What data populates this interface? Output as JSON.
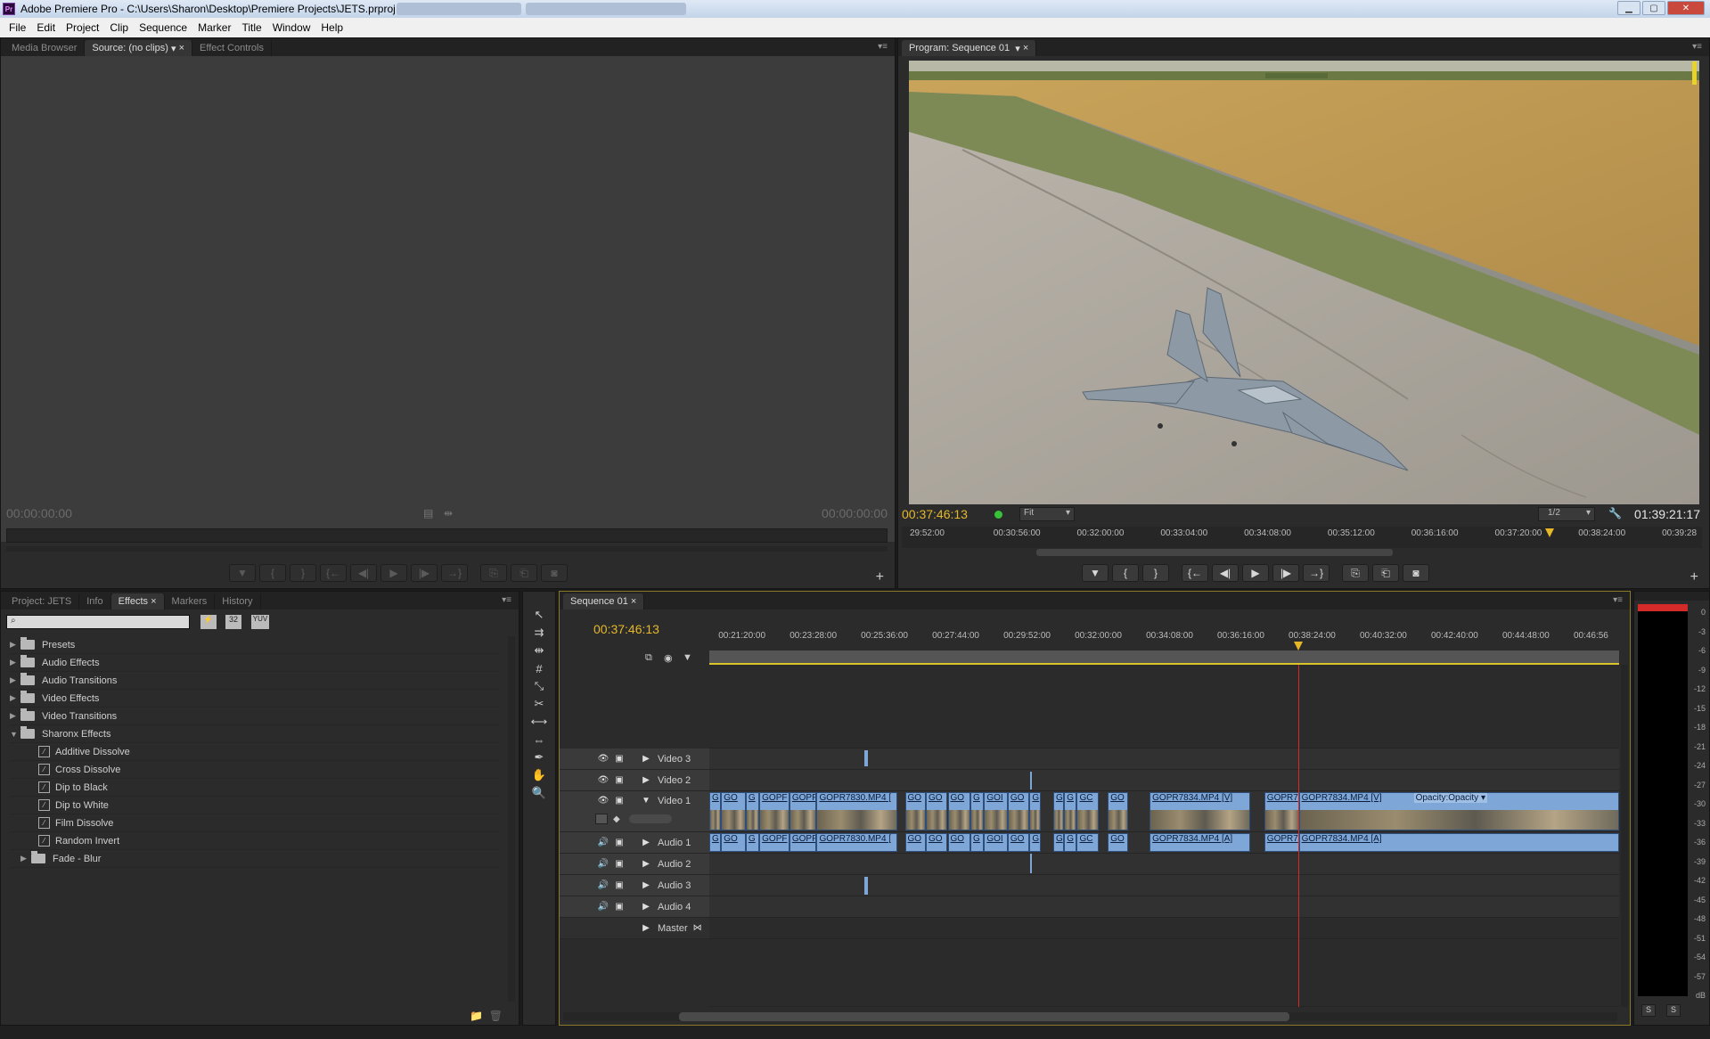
{
  "window": {
    "title": "Adobe Premiere Pro - C:\\Users\\Sharon\\Desktop\\Premiere Projects\\JETS.prproj *",
    "app_icon": "Pr"
  },
  "menu": [
    "File",
    "Edit",
    "Project",
    "Clip",
    "Sequence",
    "Marker",
    "Title",
    "Window",
    "Help"
  ],
  "source_panel": {
    "tabs": [
      "Media Browser",
      "Source: (no clips)",
      "Effect Controls"
    ],
    "timecode_in": "00:00:00:00",
    "timecode_out": "00:00:00:00"
  },
  "program_panel": {
    "tab": "Program: Sequence 01",
    "current_timecode": "00:37:46:13",
    "fit": "Fit",
    "resolution": "1/2",
    "duration": "01:39:21:17",
    "ruler": [
      "29:52:00",
      "00:30:56:00",
      "00:32:00:00",
      "00:33:04:00",
      "00:34:08:00",
      "00:35:12:00",
      "00:36:16:00",
      "00:37:20:00",
      "00:38:24:00",
      "00:39:28"
    ],
    "playhead_position": 0.81
  },
  "project_panel": {
    "tabs": [
      "Project: JETS",
      "Info",
      "Effects",
      "Markers",
      "History"
    ],
    "search_placeholder": "",
    "icon_labels": [
      "32",
      "YUV"
    ],
    "tree": [
      {
        "label": "Presets",
        "type": "folder",
        "expanded": false,
        "indent": 0
      },
      {
        "label": "Audio Effects",
        "type": "folder",
        "expanded": false,
        "indent": 0
      },
      {
        "label": "Audio Transitions",
        "type": "folder",
        "expanded": false,
        "indent": 0
      },
      {
        "label": "Video Effects",
        "type": "folder",
        "expanded": false,
        "indent": 0
      },
      {
        "label": "Video Transitions",
        "type": "folder",
        "expanded": false,
        "indent": 0
      },
      {
        "label": "Sharonx Effects",
        "type": "folder",
        "expanded": true,
        "indent": 0
      },
      {
        "label": "Additive Dissolve",
        "type": "effect",
        "indent": 1
      },
      {
        "label": "Cross Dissolve",
        "type": "effect",
        "indent": 1
      },
      {
        "label": "Dip to Black",
        "type": "effect",
        "indent": 1
      },
      {
        "label": "Dip to White",
        "type": "effect",
        "indent": 1
      },
      {
        "label": "Film Dissolve",
        "type": "effect",
        "indent": 1
      },
      {
        "label": "Random Invert",
        "type": "effect",
        "indent": 1
      },
      {
        "label": "Fade - Blur",
        "type": "folder",
        "expanded": false,
        "indent": 1
      }
    ]
  },
  "timeline": {
    "tab": "Sequence 01",
    "current_timecode": "00:37:46:13",
    "ruler": [
      "00:21:20:00",
      "00:23:28:00",
      "00:25:36:00",
      "00:27:44:00",
      "00:29:52:00",
      "00:32:00:00",
      "00:34:08:00",
      "00:36:16:00",
      "00:38:24:00",
      "00:40:32:00",
      "00:42:40:00",
      "00:44:48:00",
      "00:46:56"
    ],
    "playhead_position": 0.647,
    "tracks": {
      "video3": "Video 3",
      "video2": "Video 2",
      "video1": "Video 1",
      "audio1": "Audio 1",
      "audio2": "Audio 2",
      "audio3": "Audio 3",
      "audio4": "Audio 4",
      "master": "Master"
    },
    "video1_clips": [
      {
        "label": "G",
        "start": 0.0,
        "end": 0.013
      },
      {
        "label": "GO",
        "start": 0.013,
        "end": 0.04
      },
      {
        "label": "G",
        "start": 0.04,
        "end": 0.055
      },
      {
        "label": "GOPF",
        "start": 0.055,
        "end": 0.088
      },
      {
        "label": "GOPF",
        "start": 0.088,
        "end": 0.118
      },
      {
        "label": "GOPR7830.MP4 [",
        "start": 0.118,
        "end": 0.207
      },
      {
        "label": "GO",
        "start": 0.215,
        "end": 0.238
      },
      {
        "label": "GO",
        "start": 0.238,
        "end": 0.262
      },
      {
        "label": "GO",
        "start": 0.262,
        "end": 0.287
      },
      {
        "label": "G",
        "start": 0.287,
        "end": 0.302
      },
      {
        "label": "GOI",
        "start": 0.302,
        "end": 0.328
      },
      {
        "label": "GO",
        "start": 0.328,
        "end": 0.352
      },
      {
        "label": "G",
        "start": 0.352,
        "end": 0.364
      },
      {
        "label": "G",
        "start": 0.378,
        "end": 0.39
      },
      {
        "label": "G",
        "start": 0.39,
        "end": 0.404
      },
      {
        "label": "GC",
        "start": 0.404,
        "end": 0.428
      },
      {
        "label": "GO",
        "start": 0.438,
        "end": 0.46
      },
      {
        "label": "GOPR7834.MP4 [V]",
        "start": 0.484,
        "end": 0.595
      },
      {
        "label": "GOPR7",
        "start": 0.61,
        "end": 0.648
      },
      {
        "label": "GOPR7834.MP4 [V]",
        "start": 0.648,
        "end": 1.0
      }
    ],
    "opacity_label": "Opacity:Opacity",
    "audio1_clips": [
      {
        "label": "G",
        "start": 0.0,
        "end": 0.013
      },
      {
        "label": "GO",
        "start": 0.013,
        "end": 0.04
      },
      {
        "label": "G",
        "start": 0.04,
        "end": 0.055
      },
      {
        "label": "GOPF",
        "start": 0.055,
        "end": 0.088
      },
      {
        "label": "GOPF",
        "start": 0.088,
        "end": 0.118
      },
      {
        "label": "GOPR7830.MP4 [",
        "start": 0.118,
        "end": 0.207
      },
      {
        "label": "GO",
        "start": 0.215,
        "end": 0.238
      },
      {
        "label": "GO",
        "start": 0.238,
        "end": 0.262
      },
      {
        "label": "GO",
        "start": 0.262,
        "end": 0.287
      },
      {
        "label": "G",
        "start": 0.287,
        "end": 0.302
      },
      {
        "label": "GOI",
        "start": 0.302,
        "end": 0.328
      },
      {
        "label": "GO",
        "start": 0.328,
        "end": 0.352
      },
      {
        "label": "G",
        "start": 0.352,
        "end": 0.364
      },
      {
        "label": "G",
        "start": 0.378,
        "end": 0.39
      },
      {
        "label": "G",
        "start": 0.39,
        "end": 0.404
      },
      {
        "label": "GC",
        "start": 0.404,
        "end": 0.428
      },
      {
        "label": "GO",
        "start": 0.438,
        "end": 0.46
      },
      {
        "label": "GOPR7834.MP4 [A]",
        "start": 0.484,
        "end": 0.595
      },
      {
        "label": "GOPR7",
        "start": 0.61,
        "end": 0.648
      },
      {
        "label": "GOPR7834.MP4 [A]",
        "start": 0.648,
        "end": 1.0
      }
    ]
  },
  "audio_meter": {
    "scale": [
      "0",
      "-3",
      "-6",
      "-9",
      "-12",
      "-15",
      "-18",
      "-21",
      "-24",
      "-27",
      "-30",
      "-33",
      "-36",
      "-39",
      "-42",
      "-45",
      "-48",
      "-51",
      "-54",
      "-57",
      "dB"
    ],
    "solo_labels": [
      "S",
      "S"
    ]
  },
  "colors": {
    "accent_timecode": "#e6b829",
    "clip_blue": "#7ea7d8",
    "playhead": "#d42a2a"
  }
}
